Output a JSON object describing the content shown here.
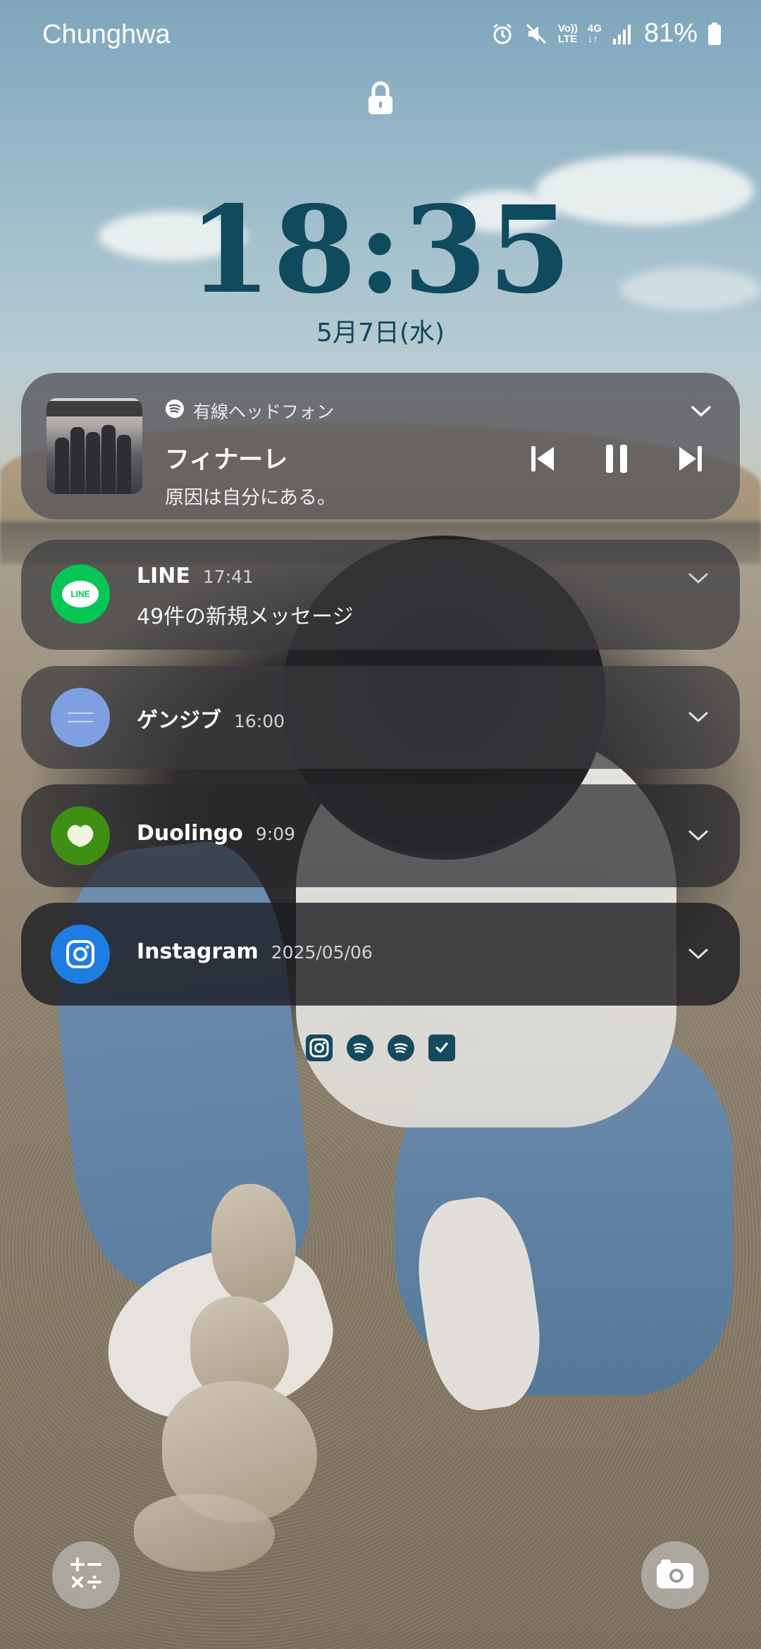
{
  "status_bar": {
    "carrier": "Chunghwa",
    "volte_label_top": "Vo))",
    "volte_label_bottom": "LTE",
    "network_label": "4G",
    "battery_percent": "81%",
    "icons": [
      "alarm-icon",
      "mute-icon",
      "volte-icon",
      "network-4g-icon",
      "signal-icon",
      "battery-icon"
    ]
  },
  "lock_screen": {
    "time": "18:35",
    "date": "5月7日(水)"
  },
  "media": {
    "source": "有線ヘッドフォン",
    "title": "フィナーレ",
    "artist": "原因は自分にある。",
    "controls": [
      "previous",
      "pause",
      "next"
    ],
    "accent": "#ffffff"
  },
  "notifications": [
    {
      "app": "LINE",
      "time": "17:41",
      "text": "49件の新規メッセージ",
      "icon": "line-icon",
      "icon_label": "LINE",
      "color": "#06c755"
    },
    {
      "app": "ゲンジブ",
      "time": "16:00",
      "text": "",
      "icon": "genjibu-icon",
      "color": "#7fa0e0"
    },
    {
      "app": "Duolingo",
      "time": "9:09",
      "text": "",
      "icon": "duolingo-icon",
      "color": "#3f8f14"
    },
    {
      "app": "Instagram",
      "time": "2025/05/06",
      "text": "",
      "icon": "instagram-icon",
      "color": "#1e7de0"
    }
  ],
  "notification_tray": [
    "instagram-icon",
    "spotify-icon",
    "spotify-icon",
    "checkbox-icon"
  ],
  "shortcuts": {
    "left": "calculator-icon",
    "right": "camera-icon"
  }
}
